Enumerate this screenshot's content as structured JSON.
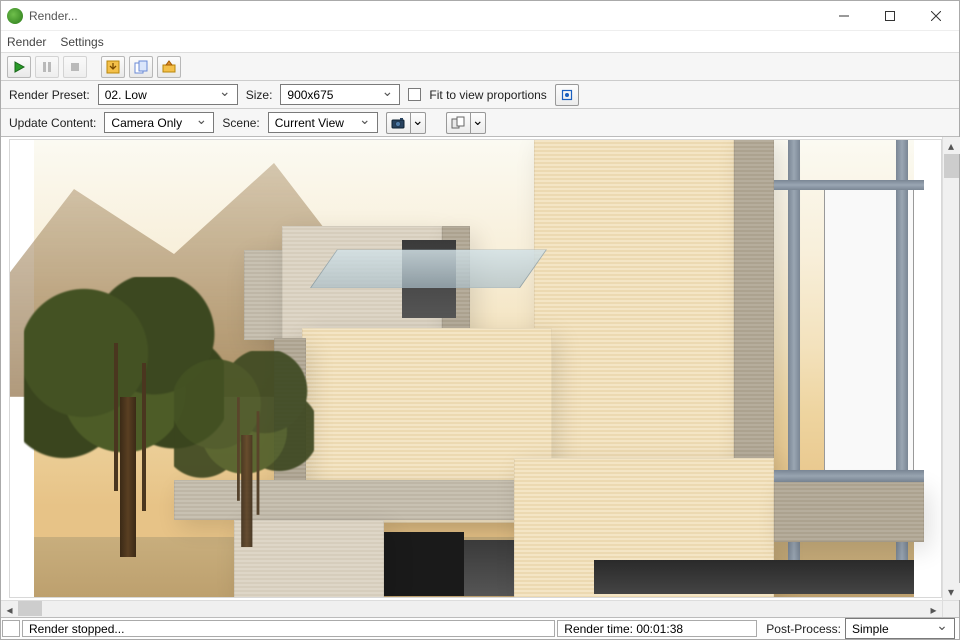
{
  "window": {
    "title": "Render..."
  },
  "menu": {
    "render": "Render",
    "settings": "Settings"
  },
  "row1": {
    "preset_label": "Render Preset:",
    "preset_value": "02. Low",
    "size_label": "Size:",
    "size_value": "900x675",
    "fit_label": "Fit to view proportions"
  },
  "row2": {
    "update_label": "Update Content:",
    "update_value": "Camera Only",
    "scene_label": "Scene:",
    "scene_value": "Current View"
  },
  "status": {
    "state": "Render stopped...",
    "time": "Render time: 00:01:38",
    "pp_label": "Post-Process:",
    "pp_value": "Simple"
  }
}
